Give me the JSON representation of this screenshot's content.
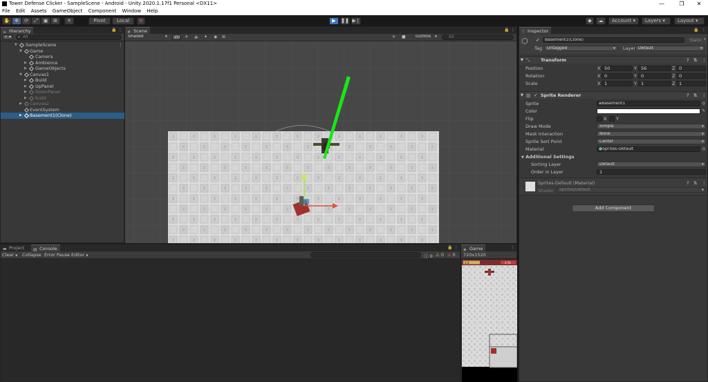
{
  "window": {
    "title": "Tower Defense Clicker - SampleScene - Android - Unity 2020.1.17f1 Personal <DX11>",
    "controls": [
      "—",
      "❐",
      "✕"
    ]
  },
  "menu": [
    "File",
    "Edit",
    "Assets",
    "GameObject",
    "Component",
    "Window",
    "Help"
  ],
  "toolbar": {
    "tools": [
      "✋",
      "✥",
      "⟳",
      "⤢",
      "▣",
      "⊞",
      "✕"
    ],
    "pivot_label": "Pivot",
    "local_label": "Local",
    "play_icon": "▶",
    "pause_icon": "❚❚",
    "step_icon": "▶❘",
    "account_label": "Account",
    "layers_label": "Layers",
    "layout_label": "Layout"
  },
  "hierarchy": {
    "tab": "Hierarchy",
    "add_label": "+ ▾",
    "search_placeholder": "All",
    "rows": [
      {
        "label": "SampleScene"
      },
      {
        "label": "Game"
      },
      {
        "label": "Camera"
      },
      {
        "label": "Ambience"
      },
      {
        "label": "GameObjects"
      },
      {
        "label": "Canvas1"
      },
      {
        "label": "Build"
      },
      {
        "label": "UpPanel"
      },
      {
        "label": "DownPanel"
      },
      {
        "label": "build"
      },
      {
        "label": "Canvas2"
      },
      {
        "label": "EventSystem"
      },
      {
        "label": "Basement1(Clone)"
      }
    ]
  },
  "scene": {
    "tab": "Scene",
    "shading_mode": "Shaded",
    "mode_2d": "2D",
    "gizmos_label": "Gizmos",
    "search_placeholder": "All"
  },
  "bottom": {
    "project_tab": "Project",
    "console_tab": "Console",
    "clear_label": "Clear",
    "collapse_label": "Collapse",
    "error_pause_label": "Error Pause",
    "editor_label": "Editor",
    "warn_count": "0",
    "error_count": "0",
    "info_count": "0"
  },
  "game": {
    "tab": "Game",
    "resolution": "720x1520",
    "coins": "4.8",
    "hp": "3.7k"
  },
  "inspector": {
    "tab": "Inspector",
    "object_name": "Basement1(Clone)",
    "static_label": "Static",
    "tag_label": "Tag",
    "tag_value": "Untagged",
    "layer_label": "Layer",
    "layer_value": "Default",
    "transform": {
      "title": "Transform",
      "position_label": "Position",
      "rotation_label": "Rotation",
      "scale_label": "Scale",
      "axis_x": "X",
      "axis_y": "Y",
      "axis_z": "Z",
      "position": [
        "50",
        "56",
        "0"
      ],
      "rotation": [
        "0",
        "0",
        "0"
      ],
      "scale": [
        "1",
        "1",
        "1"
      ]
    },
    "sprite_renderer": {
      "title": "Sprite Renderer",
      "sprite_label": "Sprite",
      "sprite_value": "Basement1",
      "color_label": "Color",
      "color_value": "#ffffff",
      "flip_label": "Flip",
      "flip_x": "X",
      "flip_y": "Y",
      "draw_mode_label": "Draw Mode",
      "draw_mode_value": "Simple",
      "mask_label": "Mask Interaction",
      "mask_value": "None",
      "sort_point_label": "Sprite Sort Point",
      "sort_point_value": "Center",
      "material_label": "Material",
      "material_value": "Sprites-Default",
      "additional_label": "Additional Settings",
      "sorting_layer_label": "Sorting Layer",
      "sorting_layer_value": "Default",
      "order_label": "Order in Layer",
      "order_value": "1"
    },
    "material": {
      "title": "Sprites-Default (Material)",
      "shader_label": "Shader",
      "shader_value": "Sprites/Default"
    },
    "add_component_label": "Add Component"
  },
  "colors": {
    "accent": "#3a79bb",
    "selection": "#2c5d87",
    "laser": "#19e619",
    "panel": "#383838"
  }
}
